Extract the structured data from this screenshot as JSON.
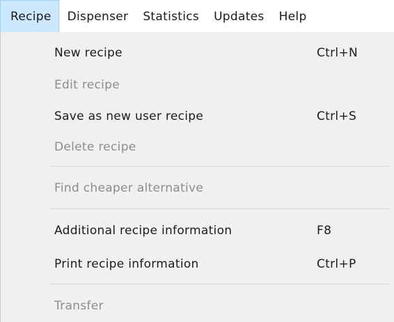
{
  "menubar": {
    "items": [
      {
        "label": "Recipe"
      },
      {
        "label": "Dispenser"
      },
      {
        "label": "Statistics"
      },
      {
        "label": "Updates"
      },
      {
        "label": "Help"
      }
    ]
  },
  "dropdown": {
    "items": [
      {
        "label": "New recipe",
        "shortcut": "Ctrl+N",
        "enabled": true
      },
      {
        "label": "Edit recipe",
        "shortcut": "",
        "enabled": false
      },
      {
        "label": "Save as new user recipe",
        "shortcut": "Ctrl+S",
        "enabled": true
      },
      {
        "label": "Delete recipe",
        "shortcut": "",
        "enabled": false
      },
      {
        "label": "Find cheaper alternative",
        "shortcut": "",
        "enabled": false
      },
      {
        "label": "Additional recipe information",
        "shortcut": "F8",
        "enabled": true
      },
      {
        "label": "Print recipe information",
        "shortcut": "Ctrl+P",
        "enabled": true
      },
      {
        "label": "Transfer",
        "shortcut": "",
        "enabled": false
      }
    ]
  },
  "colors": {
    "active_menu_bg": "#cce8ff",
    "active_menu_border": "#99d1ff",
    "dropdown_bg": "#f0f0f0",
    "disabled_text": "#8d8d8d",
    "enabled_text": "#1c1c1c"
  }
}
